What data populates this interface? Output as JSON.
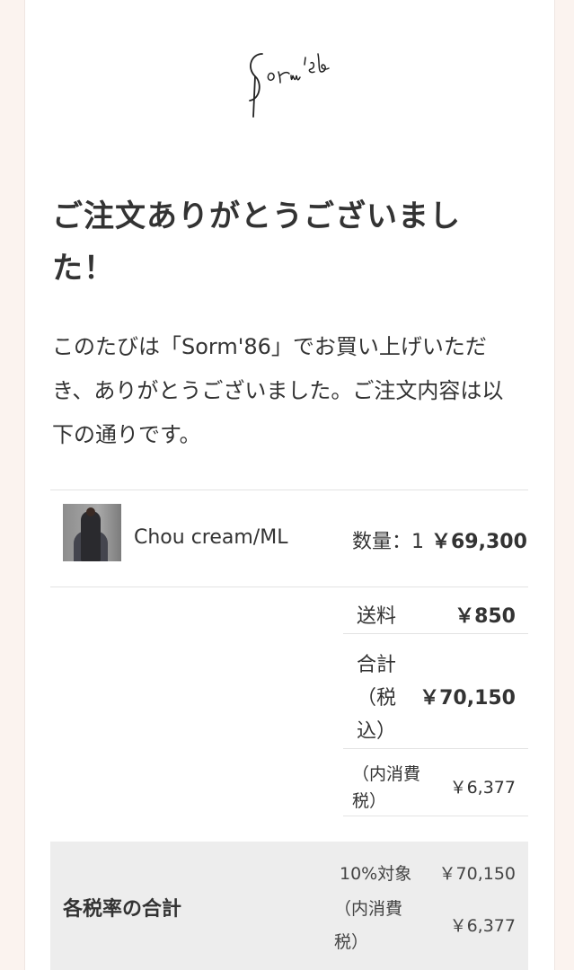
{
  "brand": {
    "logo_text": "Sorm'86"
  },
  "heading": "ご注文ありがとうございました！",
  "intro": "このたびは「Sorm'86」でお買い上げいただき、ありがとうございました。ご注文内容は以下の通りです。",
  "line_item": {
    "image_alt": "product-thumbnail",
    "name": "Chou cream/ML",
    "quantity": "数量：1",
    "price": "￥69,300"
  },
  "summary": {
    "shipping_label": "送料",
    "shipping_value": "￥850",
    "total_label_1": "合計",
    "total_label_2": "（税",
    "total_label_3": "込）",
    "total_value": "￥70,150",
    "tax_label_1": "（内消費",
    "tax_label_2": "税）",
    "tax_value": "￥6,377"
  },
  "tax_breakdown": {
    "title": "各税率の合計",
    "rate_label": "10%対象",
    "rate_value": "￥70,150",
    "tax_label_1": "（内消費",
    "tax_label_2": "税）",
    "tax_value": "￥6,377"
  }
}
